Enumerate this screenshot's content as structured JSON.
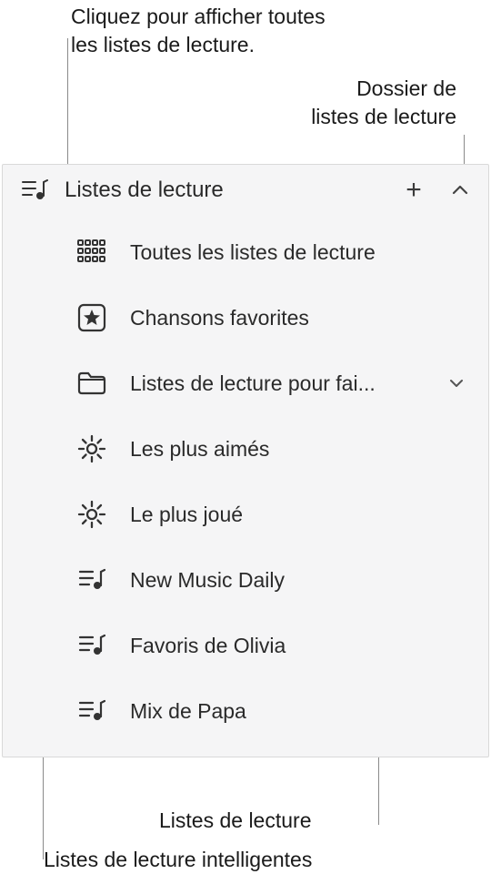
{
  "callouts": {
    "top_left": "Cliquez pour afficher toutes\nles listes de lecture.",
    "top_right": "Dossier de\nlistes de lecture",
    "bottom_right": "Listes de lecture",
    "bottom_left": "Listes de lecture intelligentes"
  },
  "header": {
    "title": "Listes de lecture"
  },
  "rows": {
    "all": {
      "label": "Toutes les listes de lecture"
    },
    "favorites": {
      "label": "Chansons favorites"
    },
    "folder": {
      "label": "Listes de lecture pour fai..."
    },
    "smart1": {
      "label": "Les plus aimés"
    },
    "smart2": {
      "label": "Le plus joué"
    },
    "pl1": {
      "label": "New Music Daily"
    },
    "pl2": {
      "label": "Favoris de Olivia"
    },
    "pl3": {
      "label": "Mix de Papa"
    }
  }
}
